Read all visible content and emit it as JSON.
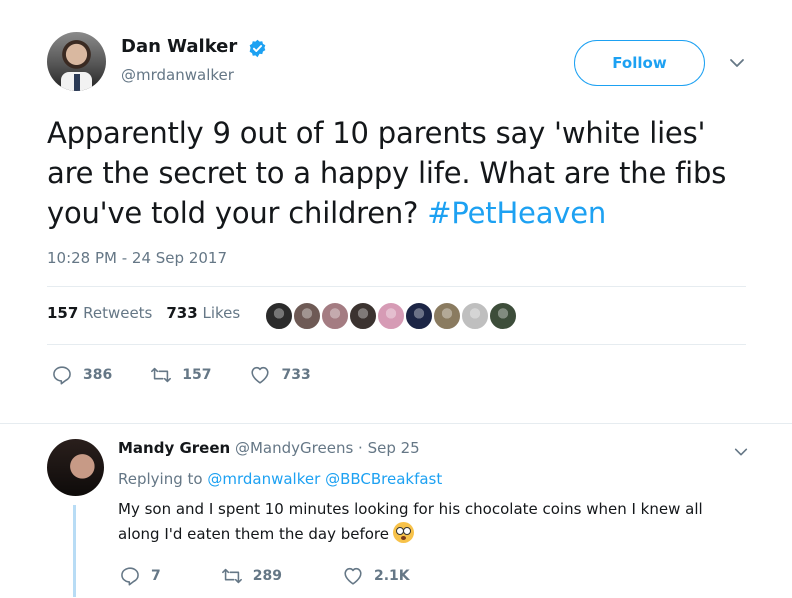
{
  "tweet": {
    "author_name": "Dan Walker",
    "author_handle": "@mrdanwalker",
    "follow_label": "Follow",
    "text_main": "Apparently 9 out of 10 parents say 'white lies' are the secret to a happy life. What are the fibs you've told your children? ",
    "hashtag": "#PetHeaven",
    "timestamp": "10:28 PM - 24 Sep 2017",
    "retweets_count": "157",
    "retweets_label": "Retweets",
    "likes_count": "733",
    "likes_label": "Likes",
    "reply_count": "386",
    "retweet_count": "157",
    "like_count": "733",
    "liker_colors": [
      "#2b2b2b",
      "#6e5a55",
      "#a47c82",
      "#3b3330",
      "#d69bb5",
      "#1c2545",
      "#8a7b60",
      "#bfbfbf",
      "#3d4d3a"
    ]
  },
  "reply": {
    "author_name": "Mandy Green",
    "author_handle": "@MandyGreens",
    "date": "· Sep 25",
    "replying_prefix": "Replying to",
    "mention_1": "@mrdanwalker",
    "mention_2": "@BBCBreakfast",
    "text": "My son and I spent 10 minutes looking for his chocolate coins when I knew all along I'd eaten them the day before",
    "reply_count": "7",
    "retweet_count": "289",
    "like_count": "2.1K"
  },
  "colors": {
    "accent": "#1da1f2",
    "muted": "#657786",
    "divider": "#e6ecf0",
    "thread": "#b8dcf5"
  },
  "icons": [
    "verified-badge-icon",
    "chevron-down-icon",
    "reply-icon",
    "retweet-icon",
    "like-icon",
    "flushed-face-emoji"
  ]
}
